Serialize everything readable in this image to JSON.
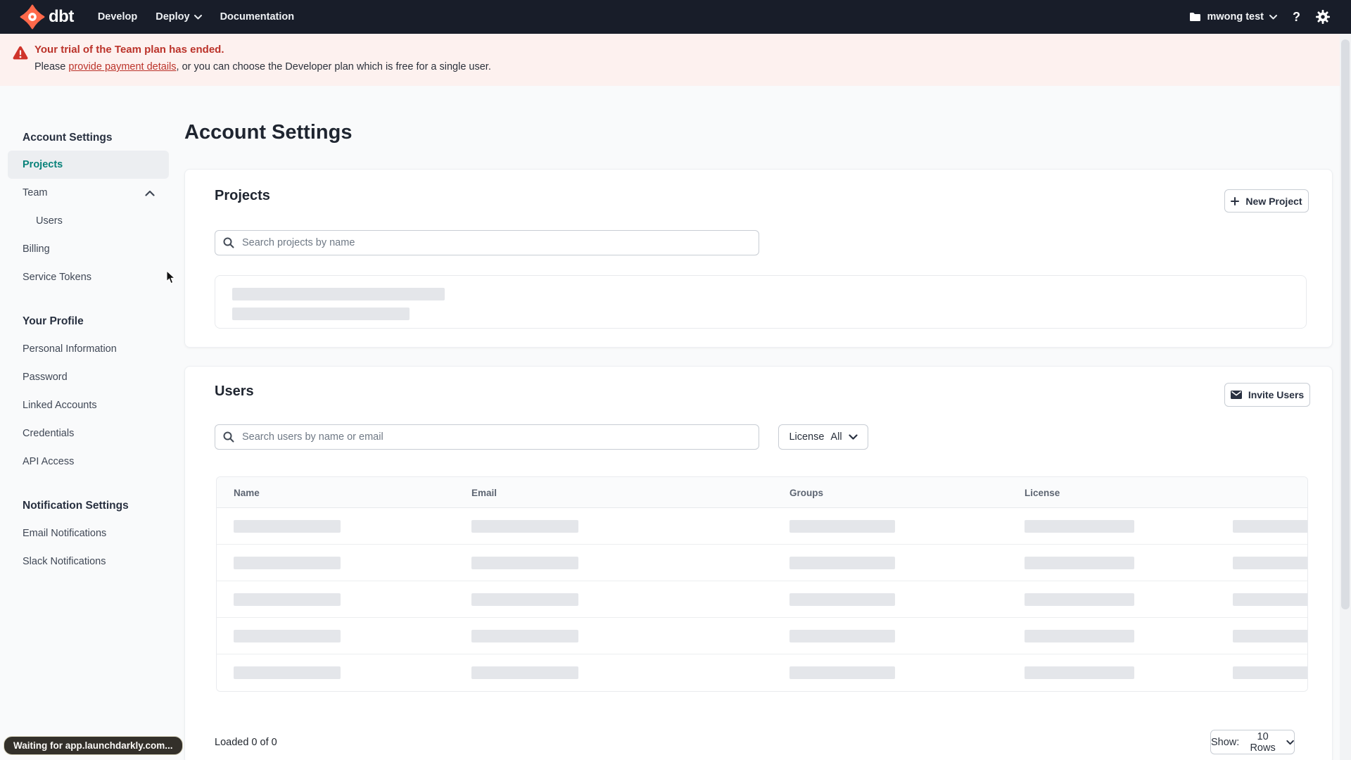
{
  "colors": {
    "nav_bg": "#181d29",
    "brand_orange": "#ff694a",
    "active_teal": "#08827a",
    "alert_red": "#bb332a",
    "banner_bg": "#fdf1ef",
    "skeleton_gray": "#e4e6ea"
  },
  "nav": {
    "logo_text": "dbt",
    "menu": [
      {
        "label": "Develop"
      },
      {
        "label": "Deploy"
      },
      {
        "label": "Documentation"
      }
    ],
    "account_label": "mwong test",
    "help_icon": "?"
  },
  "banner": {
    "title": "Your trial of the Team plan has ended.",
    "body_prefix": "Please ",
    "link_label": "provide payment details",
    "body_suffix": ", or you can choose the Developer plan which is free for a single user."
  },
  "sidebar": {
    "active_item": "Projects",
    "sections": [
      {
        "heading": "Account Settings",
        "items": [
          "Projects",
          "Team",
          "Users",
          "Billing",
          "Service Tokens"
        ]
      },
      {
        "heading": "Your Profile",
        "items": [
          "Personal Information",
          "Password",
          "Linked Accounts",
          "Credentials",
          "API Access"
        ]
      },
      {
        "heading": "Notification Settings",
        "items": [
          "Email Notifications",
          "Slack Notifications"
        ]
      }
    ]
  },
  "main": {
    "title": "Account Settings",
    "projects_card": {
      "title": "Projects",
      "new_project_button": "New Project",
      "search_placeholder": "Search projects by name",
      "loading_skeleton_lines": 2
    },
    "users_card": {
      "title": "Users",
      "invite_button": "Invite Users",
      "search_placeholder": "Search users by name or email",
      "license_filter_label": "License",
      "license_filter_value": "All",
      "table_headers": [
        "Name",
        "Email",
        "Groups",
        "License"
      ],
      "loading_skeleton_rows": 5,
      "footer": {
        "loaded_text": "Loaded 0 of 0",
        "show_label": "Show:",
        "show_value": "10 Rows"
      }
    }
  },
  "status_bubble": "Waiting for app.launchdarkly.com..."
}
